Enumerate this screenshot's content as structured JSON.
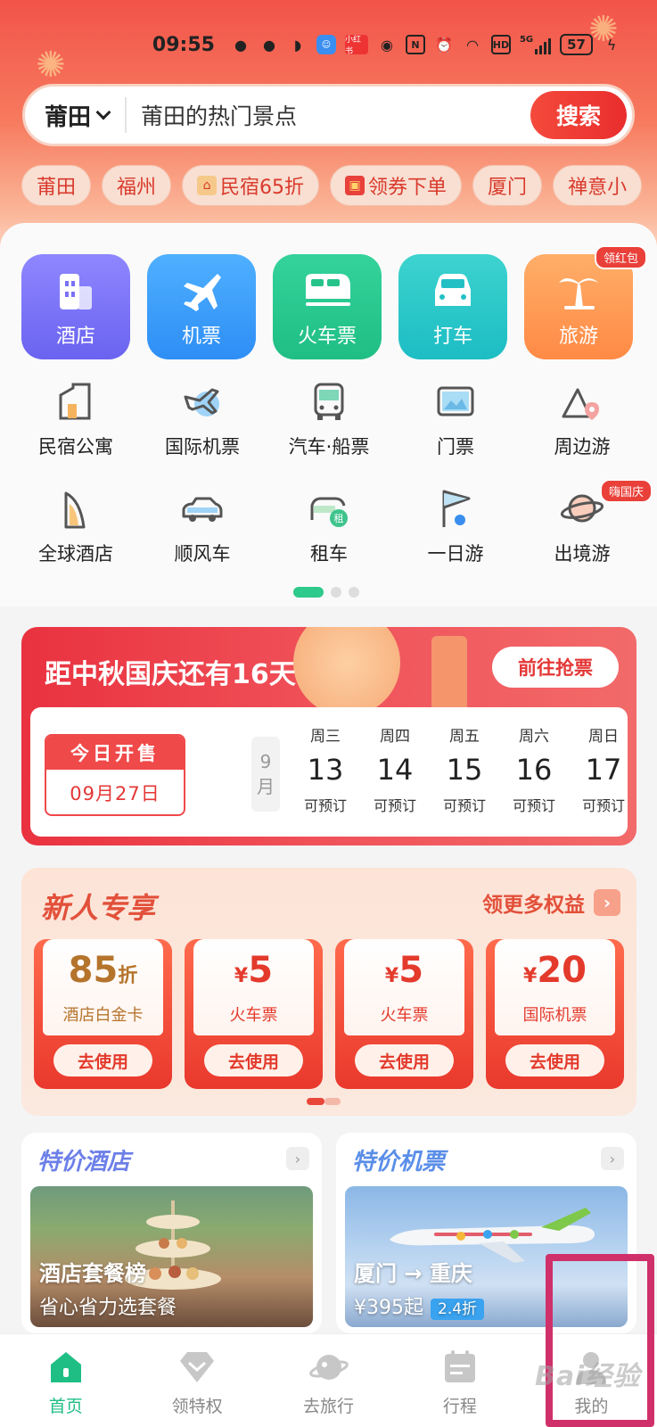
{
  "status_bar": {
    "time": "09:55",
    "network": "5G",
    "battery": "57",
    "icons": [
      "wechat-icon",
      "wechat-icon",
      "message-icon",
      "app-icon",
      "xiaohongshu-icon",
      "eye-icon",
      "nfc-icon",
      "alarm-icon",
      "wifi-icon",
      "hd-icon",
      "signal-icon",
      "battery-icon",
      "charging-icon"
    ]
  },
  "search": {
    "city": "莆田",
    "placeholder": "莆田的热门景点",
    "button_label": "搜索"
  },
  "quick_tags": [
    "莆田",
    "福州",
    "民宿65折",
    "领券下单",
    "厦门",
    "禅意小"
  ],
  "primary_services": [
    {
      "label": "酒店",
      "icon": "hotel-icon"
    },
    {
      "label": "机票",
      "icon": "plane-icon"
    },
    {
      "label": "火车票",
      "icon": "train-icon"
    },
    {
      "label": "打车",
      "icon": "car-icon"
    },
    {
      "label": "旅游",
      "icon": "palm-tree-icon",
      "badge": "领红包"
    }
  ],
  "secondary_services_row1": [
    {
      "label": "民宿公寓",
      "icon": "homestay-icon"
    },
    {
      "label": "国际机票",
      "icon": "international-flight-icon"
    },
    {
      "label": "汽车·船票",
      "icon": "bus-icon"
    },
    {
      "label": "门票",
      "icon": "ticket-icon"
    },
    {
      "label": "周边游",
      "icon": "mountain-pin-icon"
    }
  ],
  "secondary_services_row2": [
    {
      "label": "全球酒店",
      "icon": "global-hotel-icon"
    },
    {
      "label": "顺风车",
      "icon": "carpool-icon"
    },
    {
      "label": "租车",
      "icon": "car-rental-icon"
    },
    {
      "label": "一日游",
      "icon": "flag-icon"
    },
    {
      "label": "出境游",
      "icon": "planet-icon",
      "badge": "嗨国庆"
    }
  ],
  "holiday_banner": {
    "title": "距中秋国庆还有16天",
    "button_label": "前往抢票",
    "sale_today_label": "今日开售",
    "sale_date": "09月27日",
    "month_label": "9月",
    "days": [
      {
        "weekday": "周三",
        "date": "13",
        "status": "可预订"
      },
      {
        "weekday": "周四",
        "date": "14",
        "status": "可预订"
      },
      {
        "weekday": "周五",
        "date": "15",
        "status": "可预订"
      },
      {
        "weekday": "周六",
        "date": "16",
        "status": "可预订"
      },
      {
        "weekday": "周日",
        "date": "17",
        "status": "可预订"
      }
    ]
  },
  "newbie": {
    "title": "新人专享",
    "more_label": "领更多权益",
    "coupons": [
      {
        "value": "85",
        "unit": "折",
        "name": "酒店白金卡",
        "button": "去使用"
      },
      {
        "value": "5",
        "prefix": "¥",
        "name": "火车票",
        "button": "去使用"
      },
      {
        "value": "5",
        "prefix": "¥",
        "name": "火车票",
        "button": "去使用"
      },
      {
        "value": "20",
        "prefix": "¥",
        "name": "国际机票",
        "button": "去使用"
      }
    ]
  },
  "deals": {
    "hotel": {
      "title": "特价酒店",
      "headline": "酒店套餐榜",
      "subline": "省心省力选套餐"
    },
    "flight": {
      "title": "特价机票",
      "headline": "厦门 → 重庆",
      "price": "¥395起",
      "discount": "2.4折"
    }
  },
  "tabs": [
    {
      "label": "首页",
      "icon": "home-icon",
      "active": true
    },
    {
      "label": "领特权",
      "icon": "diamond-icon",
      "active": false
    },
    {
      "label": "去旅行",
      "icon": "planet-icon",
      "active": false
    },
    {
      "label": "行程",
      "icon": "itinerary-icon",
      "active": false
    },
    {
      "label": "我的",
      "icon": "profile-icon",
      "active": false
    }
  ],
  "watermark": "Bai经验"
}
